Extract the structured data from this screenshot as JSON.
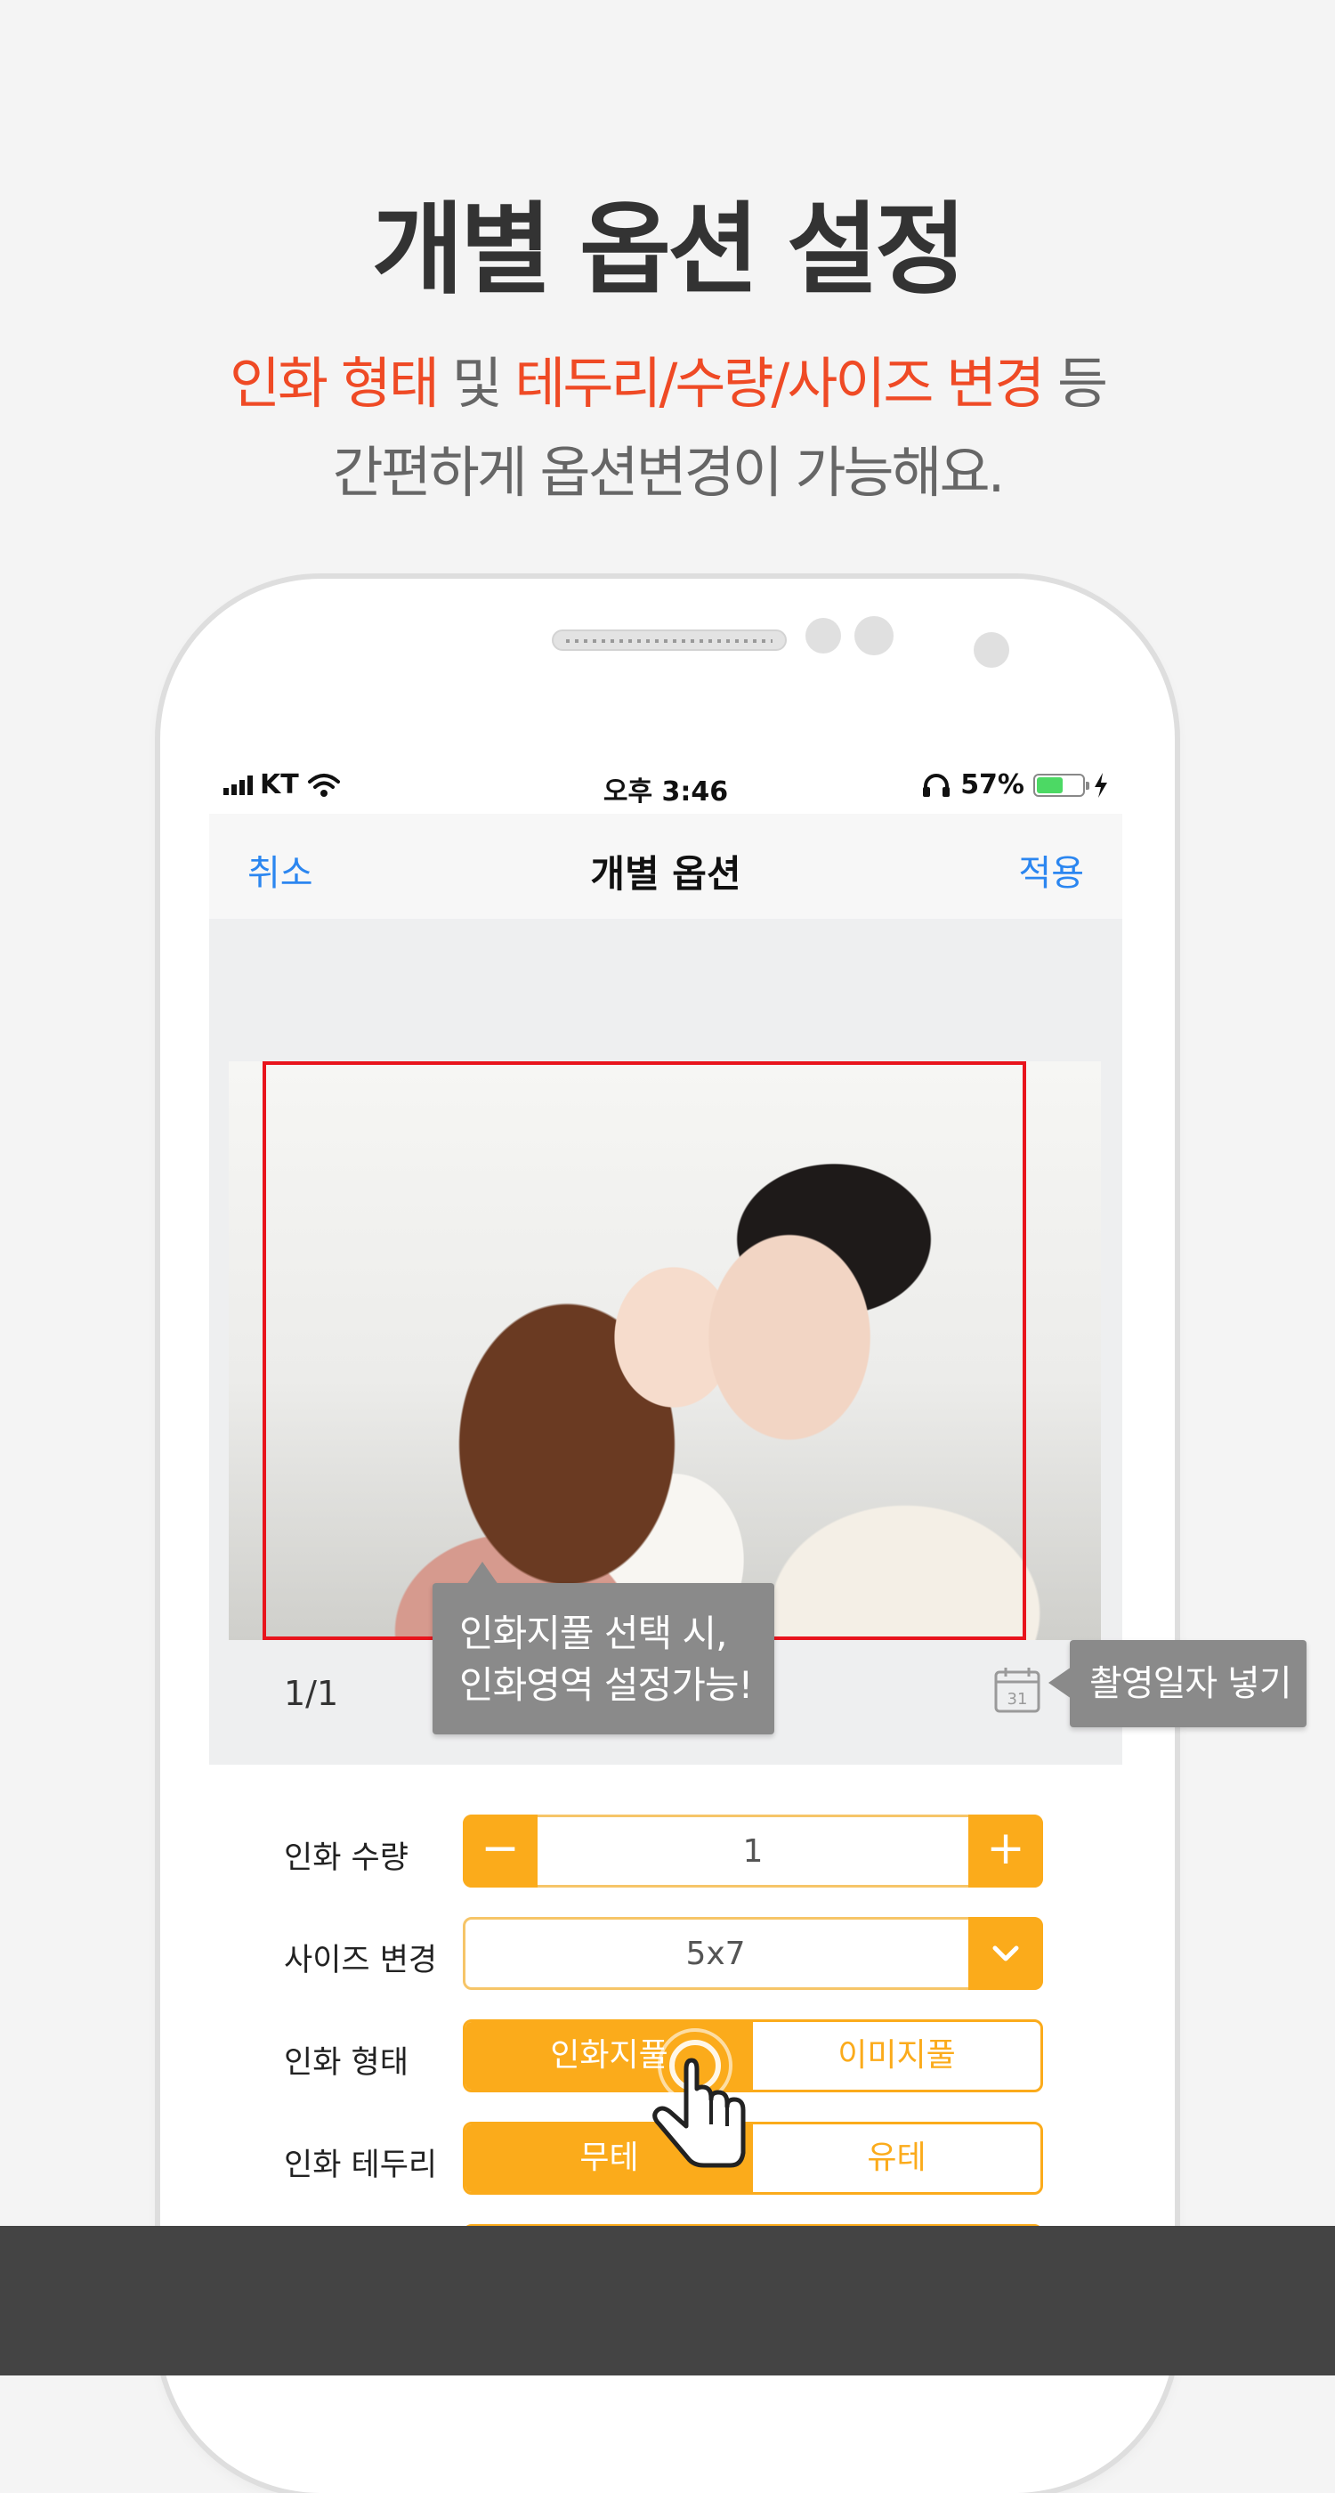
{
  "headline": "개별 옵션 설정",
  "subtitle": {
    "line1_part1": "인화 형태",
    "line1_part2": " 및 ",
    "line1_part3": "테두리/수량/사이즈 변경",
    "line1_part4": " 등",
    "line2": "간편하게 옵션변경이 가능해요."
  },
  "status_bar": {
    "carrier": "KT",
    "time": "오후 3:46",
    "battery_percent": "57%",
    "battery_level": 0.57
  },
  "nav": {
    "cancel": "취소",
    "title": "개별 옵션",
    "apply": "적용"
  },
  "preview": {
    "page_count": "1/1"
  },
  "tooltips": {
    "crop_line1": "인화지풀 선택 시,",
    "crop_line2": "인화영역 설정가능!",
    "date": "촬영일자 넣기"
  },
  "options": {
    "quantity": {
      "label": "인화 수량",
      "value": "1",
      "minus": "−",
      "plus": "+"
    },
    "size": {
      "label": "사이즈 변경",
      "value": "5x7"
    },
    "print_type": {
      "label": "인화 형태",
      "option1": "인화지풀",
      "option2": "이미지풀",
      "selected": "인화지풀"
    },
    "border": {
      "label": "인화 테두리",
      "option1": "무테",
      "option2": "유테",
      "selected": "무테"
    }
  },
  "colors": {
    "accent": "#fbab1b",
    "highlight_text": "#ef4a25",
    "link_blue": "#2b86f0",
    "crop_border": "#e8141c"
  }
}
